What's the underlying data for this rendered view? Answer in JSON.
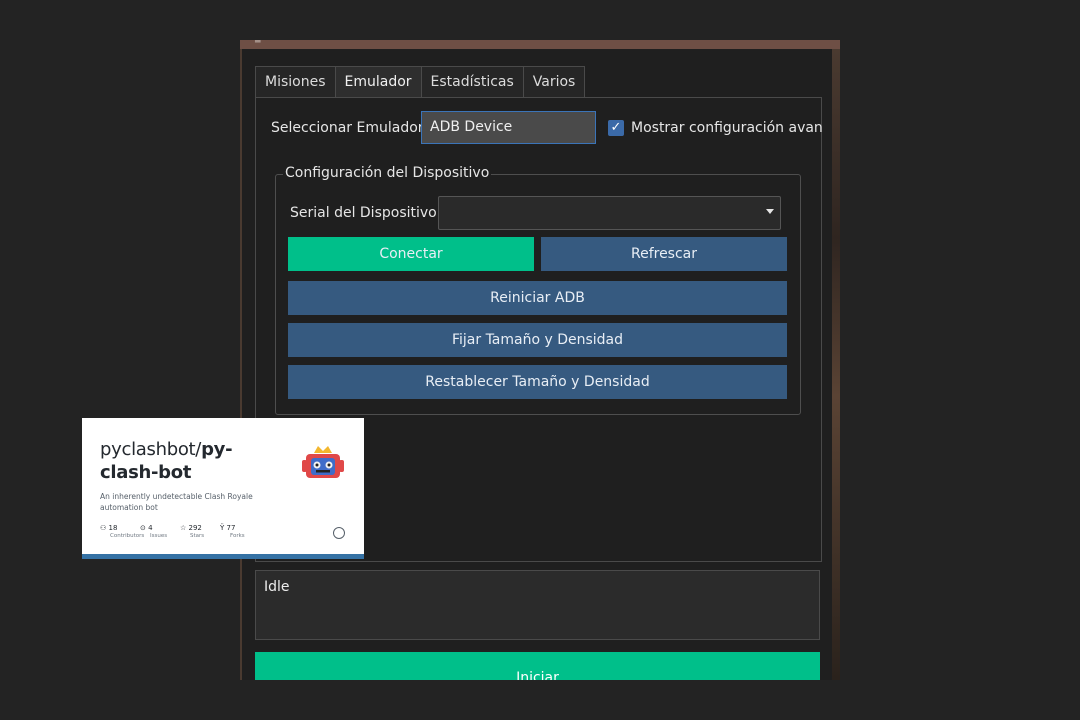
{
  "window": {
    "title_glyph": "≡"
  },
  "tabs": [
    {
      "label": "Misiones"
    },
    {
      "label": "Emulador"
    },
    {
      "label": "Estadísticas"
    },
    {
      "label": "Varios"
    }
  ],
  "emulator": {
    "select_label": "Seleccionar Emulador:",
    "select_value": "ADB Device",
    "advanced_checkbox_label": "Mostrar configuración avan",
    "advanced_checked": true
  },
  "device_group": {
    "title": "Configuración del Dispositivo",
    "serial_label": "Serial del Dispositivo:",
    "serial_value": "",
    "buttons": {
      "connect": "Conectar",
      "refresh": "Refrescar",
      "restart_adb": "Reiniciar ADB",
      "set_size": "Fijar Tamaño y Densidad",
      "reset_size": "Restablecer Tamaño y Densidad"
    }
  },
  "status": {
    "text": "Idle"
  },
  "start_button": {
    "label": "Iniciar"
  },
  "github_card": {
    "owner": "pyclashbot/",
    "repo": "py-clash-bot",
    "description": "An inherently undetectable Clash Royale automation bot",
    "stats": [
      {
        "icon": "people-icon",
        "value": "18",
        "label": "Contributors"
      },
      {
        "icon": "issue-icon",
        "value": "4",
        "label": "Issues"
      },
      {
        "icon": "star-icon",
        "value": "292",
        "label": "Stars"
      },
      {
        "icon": "fork-icon",
        "value": "77",
        "label": "Forks"
      }
    ]
  },
  "colors": {
    "accent_green": "#00bf8a",
    "button_blue": "#365a80",
    "background": "#1f1f1f"
  }
}
